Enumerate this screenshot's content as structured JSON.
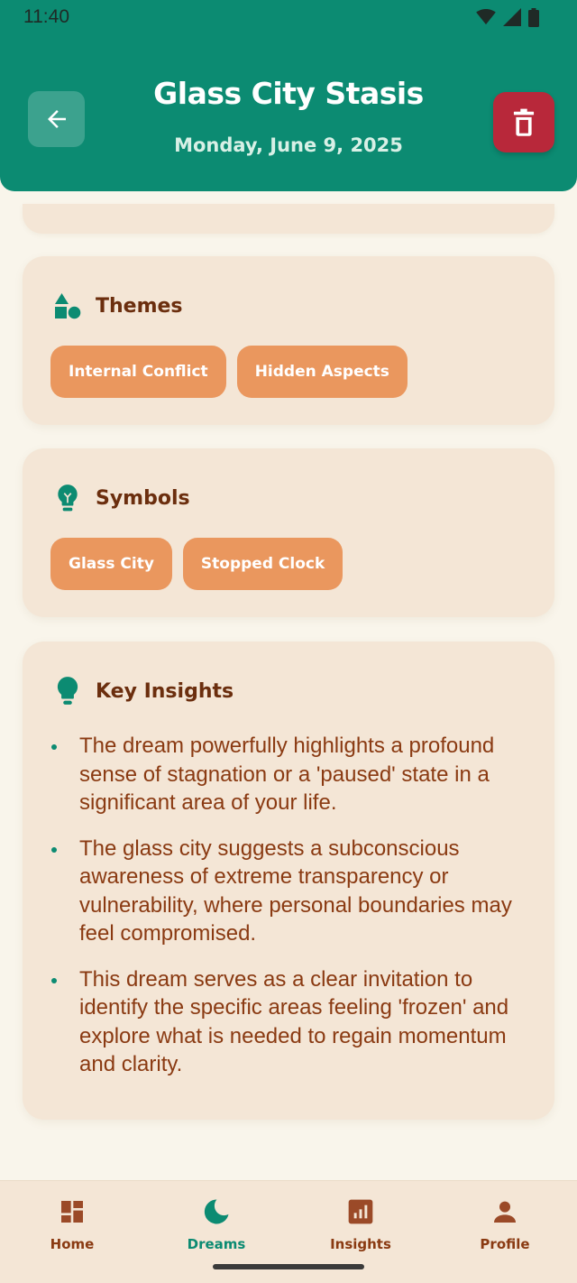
{
  "status_bar": {
    "time": "11:40"
  },
  "header": {
    "title": "Glass City Stasis",
    "date": "Monday, June 9, 2025"
  },
  "themes": {
    "heading": "Themes",
    "chips": [
      "Internal Conflict",
      "Hidden Aspects"
    ]
  },
  "symbols": {
    "heading": "Symbols",
    "chips": [
      "Glass City",
      "Stopped Clock"
    ]
  },
  "insights": {
    "heading": "Key Insights",
    "items": [
      "The dream powerfully highlights a profound sense of stagnation or a 'paused' state in a significant area of your life.",
      "The glass city suggests a subconscious awareness of extreme transparency or vulnerability, where personal boundaries may feel compromised.",
      "This dream serves as a clear invitation to identify the specific areas feeling 'frozen' and explore what is needed to regain momentum and clarity."
    ]
  },
  "bottom_nav": {
    "items": [
      {
        "label": "Home",
        "icon": "dashboard-icon"
      },
      {
        "label": "Dreams",
        "icon": "moon-icon",
        "active": true
      },
      {
        "label": "Insights",
        "icon": "bar-chart-icon"
      },
      {
        "label": "Profile",
        "icon": "person-icon"
      }
    ]
  },
  "colors": {
    "primary": "#0c8b72",
    "danger": "#b8283a",
    "chip": "#ea975e",
    "card": "#f4e6d6",
    "background": "#f9f5eb",
    "text_brown": "#6b2e0e"
  }
}
